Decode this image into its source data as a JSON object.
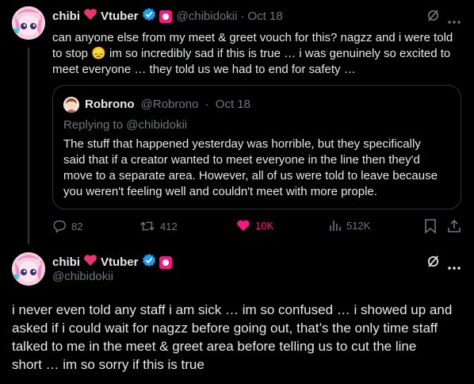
{
  "tweet1": {
    "display_name": "chibi",
    "name_suffix": "Vtuber",
    "handle": "@chibidokii",
    "separator": "·",
    "date": "Oct 18",
    "text_lines": [
      "can anyone else from my meet & greet vouch for this? nagzz and i were told",
      "to stop 😞 im so incredibly sad if this is true … i was genuinely so excited to",
      "meet everyone … they told us we had to end for safety …"
    ],
    "quote": {
      "display_name": "Robrono",
      "handle": "@Robrono",
      "separator": "·",
      "date": "Oct 18",
      "replying_to": "Replying to @chibidokii",
      "text_lines": [
        "The stuff that happened yesterday was horrible, but they specifically",
        "said that if a creator wanted to meet everyone in the line then they'd",
        "move to a separate area. However, all of us were told to leave because",
        "you weren't feeling well and couldn't meet with more prople."
      ]
    },
    "stats": {
      "replies": "82",
      "reposts": "412",
      "likes": "10K",
      "views": "512K"
    }
  },
  "tweet2": {
    "display_name": "chibi",
    "name_suffix": "Vtuber",
    "handle": "@chibidokii",
    "text_lines": [
      "i never even told any staff i am sick … im so confused … i showed up and",
      "asked if i could wait for nagzz before going out, that’s the only time staff",
      "talked to me in the meet & greet area before telling us to cut the line",
      "short … im so sorry if this is true"
    ]
  },
  "colors": {
    "background": "#000000",
    "text": "#e7e9ea",
    "muted": "#71767b",
    "like": "#f91880",
    "verified": "#1d9bf0",
    "border": "#2f3336"
  },
  "icons": [
    "heart-emoji-icon",
    "verified-icon",
    "affiliate-badge-icon",
    "grok-icon",
    "more-icon",
    "reply-icon",
    "repost-icon",
    "like-icon",
    "views-icon",
    "bookmark-icon",
    "share-icon"
  ]
}
